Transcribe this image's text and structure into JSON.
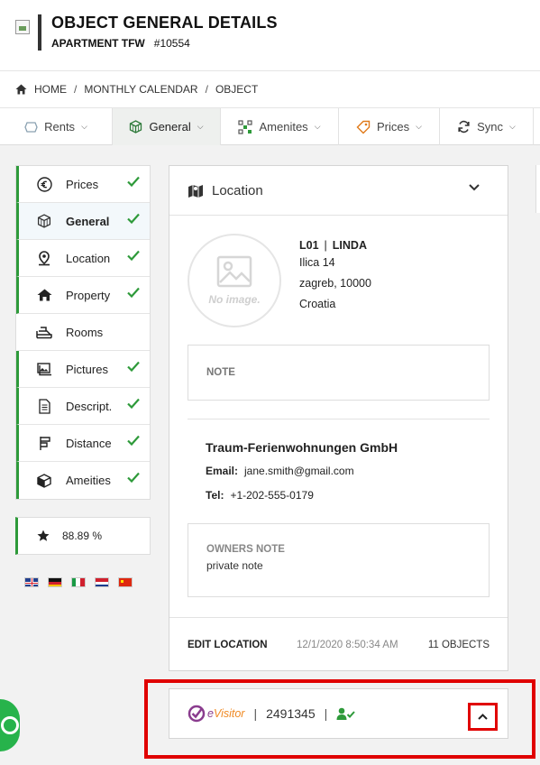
{
  "header": {
    "title": "OBJECT GENERAL DETAILS",
    "object_name": "APARTMENT TFW",
    "object_id": "#10554"
  },
  "breadcrumb": {
    "home": "HOME",
    "items": [
      "MONTHLY CALENDAR",
      "OBJECT"
    ],
    "separator": "/"
  },
  "tabs": [
    {
      "label": "Rents",
      "icon": "rents-icon"
    },
    {
      "label": "General",
      "icon": "cube-icon",
      "active": true
    },
    {
      "label": "Amenites",
      "icon": "amenities-icon"
    },
    {
      "label": "Prices",
      "icon": "tag-icon"
    },
    {
      "label": "Sync",
      "icon": "sync-icon"
    }
  ],
  "sidebar": {
    "items": [
      {
        "label": "Prices",
        "icon": "euro-icon",
        "done": true
      },
      {
        "label": "General",
        "icon": "cube-icon",
        "done": true,
        "active": true
      },
      {
        "label": "Location",
        "icon": "location-pin-icon",
        "done": true
      },
      {
        "label": "Property",
        "icon": "house-icon",
        "done": true
      },
      {
        "label": "Rooms",
        "icon": "bed-icon",
        "done": false
      },
      {
        "label": "Pictures",
        "icon": "pictures-icon",
        "done": true
      },
      {
        "label": "Descript.",
        "icon": "document-icon",
        "done": true
      },
      {
        "label": "Distance",
        "icon": "distance-icon",
        "done": true
      },
      {
        "label": "Ameities",
        "icon": "box-icon",
        "done": true
      }
    ],
    "score": "88.89 %",
    "languages": [
      "en",
      "de",
      "it",
      "hr",
      "cn"
    ]
  },
  "location": {
    "heading": "Location",
    "no_image": "No image.",
    "code": "L01",
    "name": "LINDA",
    "street": "Ilica 14",
    "city": "zagreb, 10000",
    "country": "Croatia",
    "note_label": "NOTE",
    "company": "Traum-Ferienwohnungen GmbH",
    "email_label": "Email:",
    "email": "jane.smith@gmail.com",
    "tel_label": "Tel:",
    "tel": "+1-202-555-0179",
    "owners_note_label": "OWNERS NOTE",
    "owners_note": "private note",
    "edit_label": "EDIT LOCATION",
    "updated": "12/1/2020 8:50:34 AM",
    "objects_count": "11 OBJECTS"
  },
  "evisitor": {
    "logo_e": "e",
    "logo_rest": "Visitor",
    "number": "2491345",
    "separator": "|"
  },
  "colors": {
    "accent_green": "#2e9a3a",
    "highlight_red": "#e00000",
    "evisitor_orange": "#f08a24",
    "evisitor_purple": "#8a3c8e"
  }
}
